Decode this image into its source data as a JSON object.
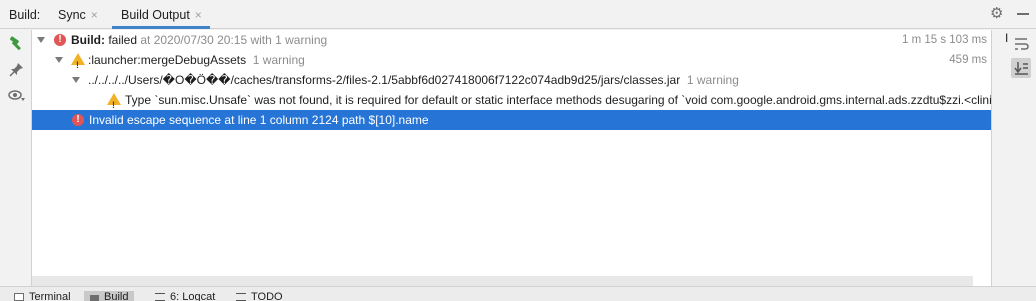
{
  "header": {
    "label": "Build:",
    "tabs": [
      {
        "label": "Sync",
        "close": "×"
      },
      {
        "label": "Build Output",
        "close": "×"
      }
    ]
  },
  "tree": {
    "row1": {
      "bold": "Build:",
      "text": " failed",
      "muted": " at 2020/07/30 20:15 with 1 warning",
      "time": "1 m 15 s 103 ms"
    },
    "row2": {
      "text": ":launcher:mergeDebugAssets",
      "muted": "1 warning",
      "time": "459 ms"
    },
    "row3": {
      "text": "../../../../Users/�O�Ö��/caches/transforms-2/files-2.1/5abbf6d027418006f7122c074adb9d25/jars/classes.jar",
      "muted": "1 warning"
    },
    "row4": {
      "text": "Type `sun.misc.Unsafe` was not found, it is required for default or static interface methods desugaring of `void com.google.android.gms.internal.ads.zzdtu$zzi.<clinit>"
    },
    "row5": {
      "text": "Invalid escape sequence at line 1 column 2124 path $[10].name"
    }
  },
  "right_tools": {
    "cursor": "I"
  },
  "bottom_tabs": [
    {
      "label": "Terminal",
      "icon": "terminal-icon"
    },
    {
      "label": "Build",
      "icon": "hammer-icon"
    },
    {
      "label": "6: Logcat",
      "icon": "logcat-icon"
    },
    {
      "label": "TODO",
      "icon": "todo-icon"
    }
  ],
  "colors": {
    "selection": "#2675d6",
    "error": "#e05555",
    "warning": "#f2b227",
    "tab_underline": "#4083c9"
  }
}
